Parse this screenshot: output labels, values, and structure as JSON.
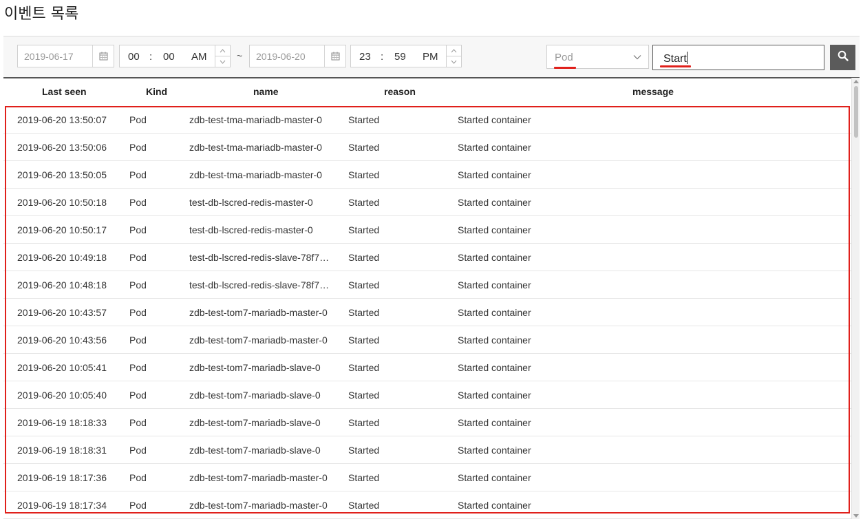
{
  "page": {
    "title": "이벤트 목록"
  },
  "filters": {
    "start_date": "2019-06-17",
    "start_hour": "00",
    "start_minute": "00",
    "start_ampm": "AM",
    "range_separator": "~",
    "end_date": "2019-06-20",
    "end_hour": "23",
    "end_minute": "59",
    "end_ampm": "PM",
    "time_separator": ":",
    "kind_select": "Pod",
    "search_value": "Start"
  },
  "icons": {
    "calendar": "calendar-icon",
    "spinner_up": "chevron-up-icon",
    "spinner_down": "chevron-down-icon",
    "select_caret": "chevron-down-icon",
    "search": "search-icon"
  },
  "colors": {
    "highlight": "#e0201b",
    "search_button": "#5b5b5b"
  },
  "table": {
    "headers": [
      "Last seen",
      "Kind",
      "name",
      "reason",
      "message"
    ],
    "rows": [
      [
        "2019-06-20 13:50:07",
        "Pod",
        "zdb-test-tma-mariadb-master-0",
        "Started",
        "Started container"
      ],
      [
        "2019-06-20 13:50:06",
        "Pod",
        "zdb-test-tma-mariadb-master-0",
        "Started",
        "Started container"
      ],
      [
        "2019-06-20 13:50:05",
        "Pod",
        "zdb-test-tma-mariadb-master-0",
        "Started",
        "Started container"
      ],
      [
        "2019-06-20 10:50:18",
        "Pod",
        "test-db-lscred-redis-master-0",
        "Started",
        "Started container"
      ],
      [
        "2019-06-20 10:50:17",
        "Pod",
        "test-db-lscred-redis-master-0",
        "Started",
        "Started container"
      ],
      [
        "2019-06-20 10:49:18",
        "Pod",
        "test-db-lscred-redis-slave-78f7…",
        "Started",
        "Started container"
      ],
      [
        "2019-06-20 10:48:18",
        "Pod",
        "test-db-lscred-redis-slave-78f7…",
        "Started",
        "Started container"
      ],
      [
        "2019-06-20 10:43:57",
        "Pod",
        "zdb-test-tom7-mariadb-master-0",
        "Started",
        "Started container"
      ],
      [
        "2019-06-20 10:43:56",
        "Pod",
        "zdb-test-tom7-mariadb-master-0",
        "Started",
        "Started container"
      ],
      [
        "2019-06-20 10:05:41",
        "Pod",
        "zdb-test-tom7-mariadb-slave-0",
        "Started",
        "Started container"
      ],
      [
        "2019-06-20 10:05:40",
        "Pod",
        "zdb-test-tom7-mariadb-slave-0",
        "Started",
        "Started container"
      ],
      [
        "2019-06-19 18:18:33",
        "Pod",
        "zdb-test-tom7-mariadb-slave-0",
        "Started",
        "Started container"
      ],
      [
        "2019-06-19 18:18:31",
        "Pod",
        "zdb-test-tom7-mariadb-slave-0",
        "Started",
        "Started container"
      ],
      [
        "2019-06-19 18:17:36",
        "Pod",
        "zdb-test-tom7-mariadb-master-0",
        "Started",
        "Started container"
      ],
      [
        "2019-06-19 18:17:34",
        "Pod",
        "zdb-test-tom7-mariadb-master-0",
        "Started",
        "Started container"
      ]
    ]
  }
}
